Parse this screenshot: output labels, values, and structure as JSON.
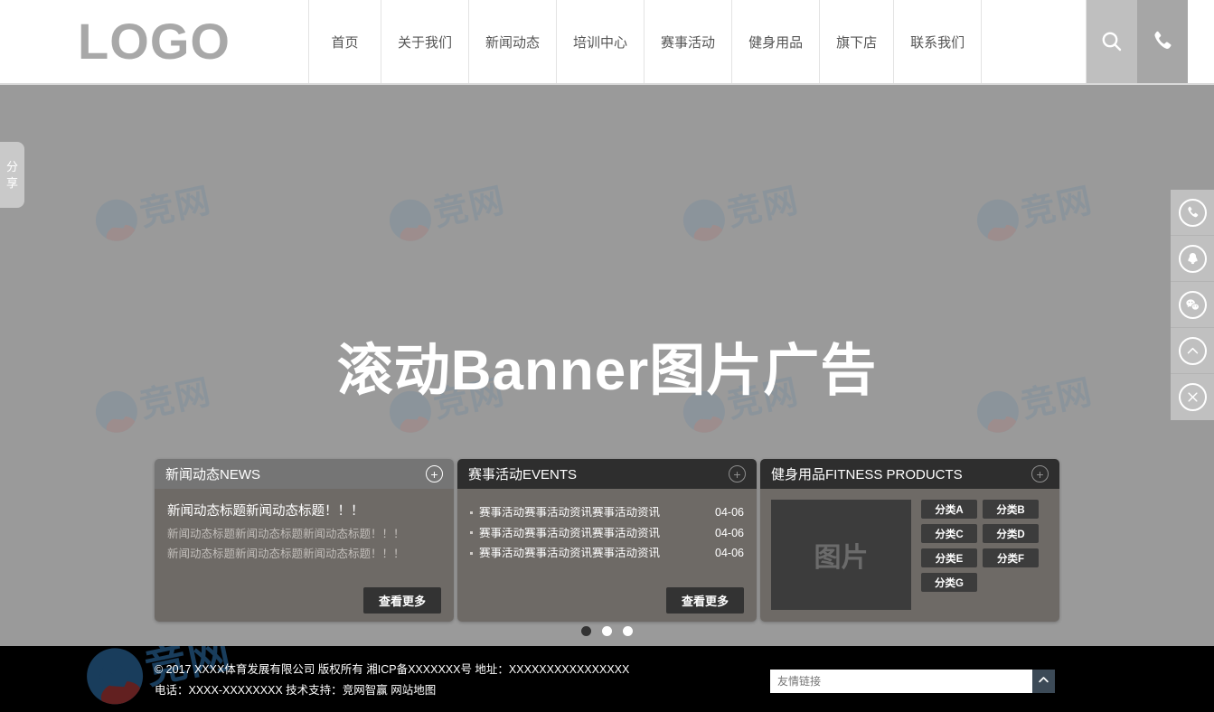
{
  "header": {
    "logo": "LOGO",
    "nav": [
      {
        "label": "首页"
      },
      {
        "label": "关于我们"
      },
      {
        "label": "新闻动态"
      },
      {
        "label": "培训中心"
      },
      {
        "label": "赛事活动"
      },
      {
        "label": "健身用品"
      },
      {
        "label": "旗下店"
      },
      {
        "label": "联系我们"
      }
    ],
    "search_icon": "search-icon",
    "phone_icon": "phone-icon"
  },
  "share_tab": {
    "line1": "分",
    "line2": "享"
  },
  "banner": {
    "title": "滚动Banner图片广告",
    "watermark_text": "竞网",
    "background_color": "#9a9a9a"
  },
  "cards": {
    "news": {
      "title": "新闻动态NEWS",
      "plus": "+",
      "headline": "新闻动态标题新闻动态标题！！！",
      "sub_lines": [
        "新闻动态标题新闻动态标题新闻动态标题！！！",
        "新闻动态标题新闻动态标题新闻动态标题！！！"
      ],
      "more_label": "查看更多"
    },
    "events": {
      "title": "赛事活动EVENTS",
      "plus": "+",
      "items": [
        {
          "text": "赛事活动赛事活动资讯赛事活动资讯",
          "date": "04-06"
        },
        {
          "text": "赛事活动赛事活动资讯赛事活动资讯",
          "date": "04-06"
        },
        {
          "text": "赛事活动赛事活动资讯赛事活动资讯",
          "date": "04-06"
        }
      ],
      "more_label": "查看更多"
    },
    "products": {
      "title": "健身用品FITNESS PRODUCTS",
      "plus": "+",
      "image_placeholder": "图片",
      "categories": [
        {
          "label": "分类A"
        },
        {
          "label": "分类B"
        },
        {
          "label": "分类C"
        },
        {
          "label": "分类D"
        },
        {
          "label": "分类E"
        },
        {
          "label": "分类F"
        },
        {
          "label": "分类G"
        }
      ]
    }
  },
  "carousel": {
    "dots": 3,
    "active_index": 0
  },
  "floatbar": {
    "items": [
      {
        "icon": "phone-icon"
      },
      {
        "icon": "qq-icon"
      },
      {
        "icon": "wechat-icon"
      },
      {
        "icon": "back-to-top-icon"
      },
      {
        "icon": "close-icon"
      }
    ]
  },
  "footer": {
    "line1": "© 2017 XXXX体育发展有限公司 版权所有 湘ICP备XXXXXXX号 地址：XXXXXXXXXXXXXXXX",
    "line2_prefix": "电话：XXXX-XXXXXXXX 技术支持：",
    "line2_support": "竞网智赢",
    "line2_sitemap": "网站地图",
    "links_placeholder": "友情链接",
    "links_value": "",
    "watermark_text": "竞网"
  }
}
